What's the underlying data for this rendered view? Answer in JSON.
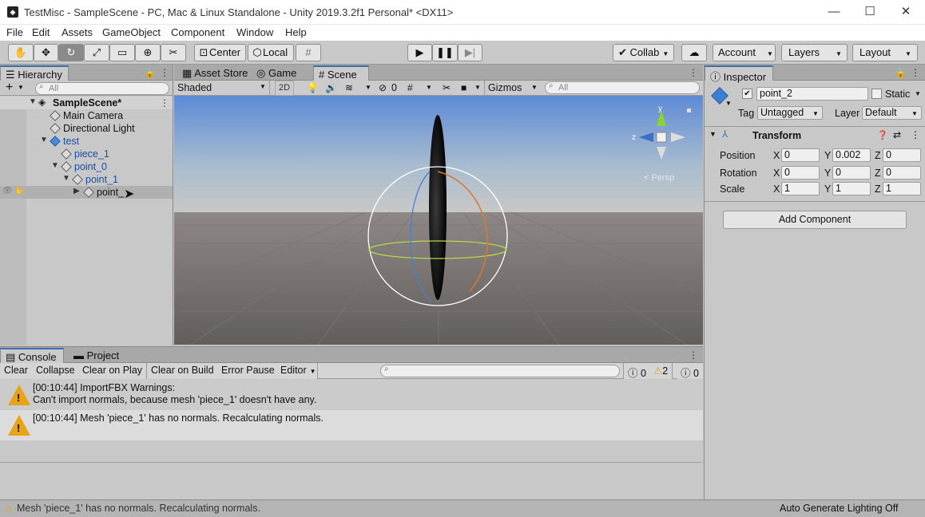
{
  "window": {
    "title": "TestMisc - SampleScene - PC, Mac & Linux Standalone - Unity 2019.3.2f1 Personal* <DX11>",
    "minimize": "—",
    "maximize": "☐",
    "close": "✕"
  },
  "menu": [
    "File",
    "Edit",
    "Assets",
    "GameObject",
    "Component",
    "Window",
    "Help"
  ],
  "toolbar": {
    "pivot": "Center",
    "space": "Local",
    "collab": "Collab",
    "account": "Account",
    "layers": "Layers",
    "layout": "Layout"
  },
  "hierarchy": {
    "tab": "Hierarchy",
    "search_placeholder": "All",
    "add": "+",
    "items": [
      {
        "label": "SampleScene*"
      },
      {
        "label": "Main Camera"
      },
      {
        "label": "Directional Light"
      },
      {
        "label": "test"
      },
      {
        "label": "piece_1"
      },
      {
        "label": "point_0"
      },
      {
        "label": "point_1"
      },
      {
        "label": "point_"
      }
    ]
  },
  "scene": {
    "tabs": [
      "Asset Store",
      "Game",
      "Scene"
    ],
    "shading": "Shaded",
    "mode2d": "2D",
    "hidden_count": "0",
    "gizmos": "Gizmos",
    "search_placeholder": "All",
    "axis_y": "y",
    "axis_z": "z",
    "persp": "< Persp"
  },
  "inspector": {
    "tab": "Inspector",
    "object_name": "point_2",
    "static_label": "Static",
    "tag_label": "Tag",
    "tag_value": "Untagged",
    "layer_label": "Layer",
    "layer_value": "Default",
    "transform": {
      "title": "Transform",
      "position": {
        "label": "Position",
        "x": "0",
        "y": "0.002",
        "z": "0"
      },
      "rotation": {
        "label": "Rotation",
        "x": "0",
        "y": "0",
        "z": "0"
      },
      "scale": {
        "label": "Scale",
        "x": "1",
        "y": "1",
        "z": "1"
      }
    },
    "add_component": "Add Component"
  },
  "console": {
    "tabs": [
      "Console",
      "Project"
    ],
    "buttons": [
      "Clear",
      "Collapse",
      "Clear on Play",
      "Clear on Build",
      "Error Pause",
      "Editor"
    ],
    "counts": {
      "info": "0",
      "warn": "2",
      "error": "0"
    },
    "messages": [
      {
        "line1": "[00:10:44] ImportFBX Warnings:",
        "line2": "Can't import normals, because mesh 'piece_1' doesn't have any."
      },
      {
        "line1": "[00:10:44] Mesh 'piece_1' has no normals. Recalculating normals.",
        "line2": ""
      }
    ]
  },
  "status": {
    "message": "Mesh 'piece_1' has no normals. Recalculating normals.",
    "lighting": "Auto Generate Lighting Off"
  },
  "colors": {
    "accent": "#3a72b0",
    "warning": "#e8a317",
    "sky_top": "#5f8fd8",
    "ground": "#6e6a68"
  }
}
